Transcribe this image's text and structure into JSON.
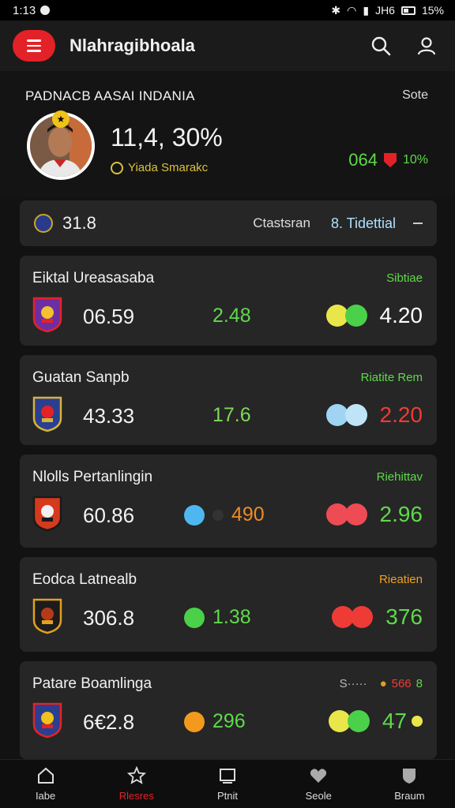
{
  "status_bar": {
    "time": "1:13",
    "battery": "15%",
    "net": "JH6"
  },
  "app_bar": {
    "title": "Nlahragibhoala"
  },
  "hero": {
    "section_title": "PADNACB AASAI INDANIA",
    "sort_label": "Sote",
    "big_value": "11,4, 30%",
    "subtitle": "Yiada Smarakc",
    "stat_value": "064",
    "stat_percent": "10%",
    "colors": {
      "green": "#5fd94a",
      "gold": "#d9c23a",
      "red": "#e32227"
    }
  },
  "filter": {
    "number": "31.8",
    "label": "Ctastsran",
    "option_num": "8.",
    "option": "Tidettial"
  },
  "cards": [
    {
      "name": "Eiktal Ureasasaba",
      "tag": "Sibtiae",
      "tag_color": "#5fd94a",
      "score": "06.59",
      "mid_value": "2.48",
      "mid_color": "#5fd94a",
      "right_value": "4.20",
      "right_color": "#ffffff",
      "dot_colors": [
        "#e9e64a",
        "#4bd04a"
      ],
      "crest_colors": [
        "#6b2fa3",
        "#e32227",
        "#f2c12e"
      ]
    },
    {
      "name": "Guatan Sanpb",
      "tag": "Riatite Rem",
      "tag_color": "#5fd94a",
      "score": "43.33",
      "mid_value": "17.6",
      "mid_color": "#7ed957",
      "right_value": "2.20",
      "right_color": "#ef3b36",
      "dot_colors": [
        "#9fd5f2",
        "#bfe4f7"
      ],
      "crest_colors": [
        "#2a3f8f",
        "#d7b23a",
        "#e32227"
      ]
    },
    {
      "name": "Nlolls Pertanlingin",
      "tag": "Riehittav",
      "tag_color": "#5fd94a",
      "score": "60.86",
      "mid_value": "490",
      "mid_color": "#f08a24",
      "mid_dot": "#4fb7f0",
      "right_value": "2.96",
      "right_color": "#5fd94a",
      "dot_colors": [
        "#ef4b55",
        "#ef4b55"
      ],
      "crest_colors": [
        "#d63a1d",
        "#1a1a1a",
        "#f0f0f0"
      ]
    },
    {
      "name": "Eodca Latnealb",
      "tag": "Rieatien",
      "tag_color": "#f0a020",
      "score": "306.8",
      "mid_value": "1.38",
      "mid_color": "#5fd94a",
      "mid_dot": "#4bd04a",
      "right_value": "376",
      "right_color": "#5fd94a",
      "dot_colors": [
        "#ef3b36",
        "#ef3b36"
      ],
      "crest_colors": [
        "#1c1c1c",
        "#e0a020",
        "#b53a1a"
      ]
    },
    {
      "name": "Patare Boamlinga",
      "tag": "566",
      "tag_prefix": "S·····",
      "tag_suffix": "8",
      "tag_color": "#ef3b36",
      "score": "6€2.8",
      "mid_value": "296",
      "mid_color": "#5fd94a",
      "mid_dot": "#f39a1c",
      "right_value": "47",
      "right_color": "#5fd94a",
      "dot_colors": [
        "#e9e64a",
        "#4bd04a"
      ],
      "crest_colors": [
        "#2a3f8f",
        "#e32227",
        "#f0c21a"
      ]
    }
  ],
  "bottom_nav": [
    {
      "label": "Iabe",
      "icon": "home-icon"
    },
    {
      "label": "Rlesres",
      "icon": "star-icon"
    },
    {
      "label": "Ptnit",
      "icon": "screen-icon"
    },
    {
      "label": "Seole",
      "icon": "heart-icon"
    },
    {
      "label": "Braum",
      "icon": "shield-icon"
    }
  ]
}
